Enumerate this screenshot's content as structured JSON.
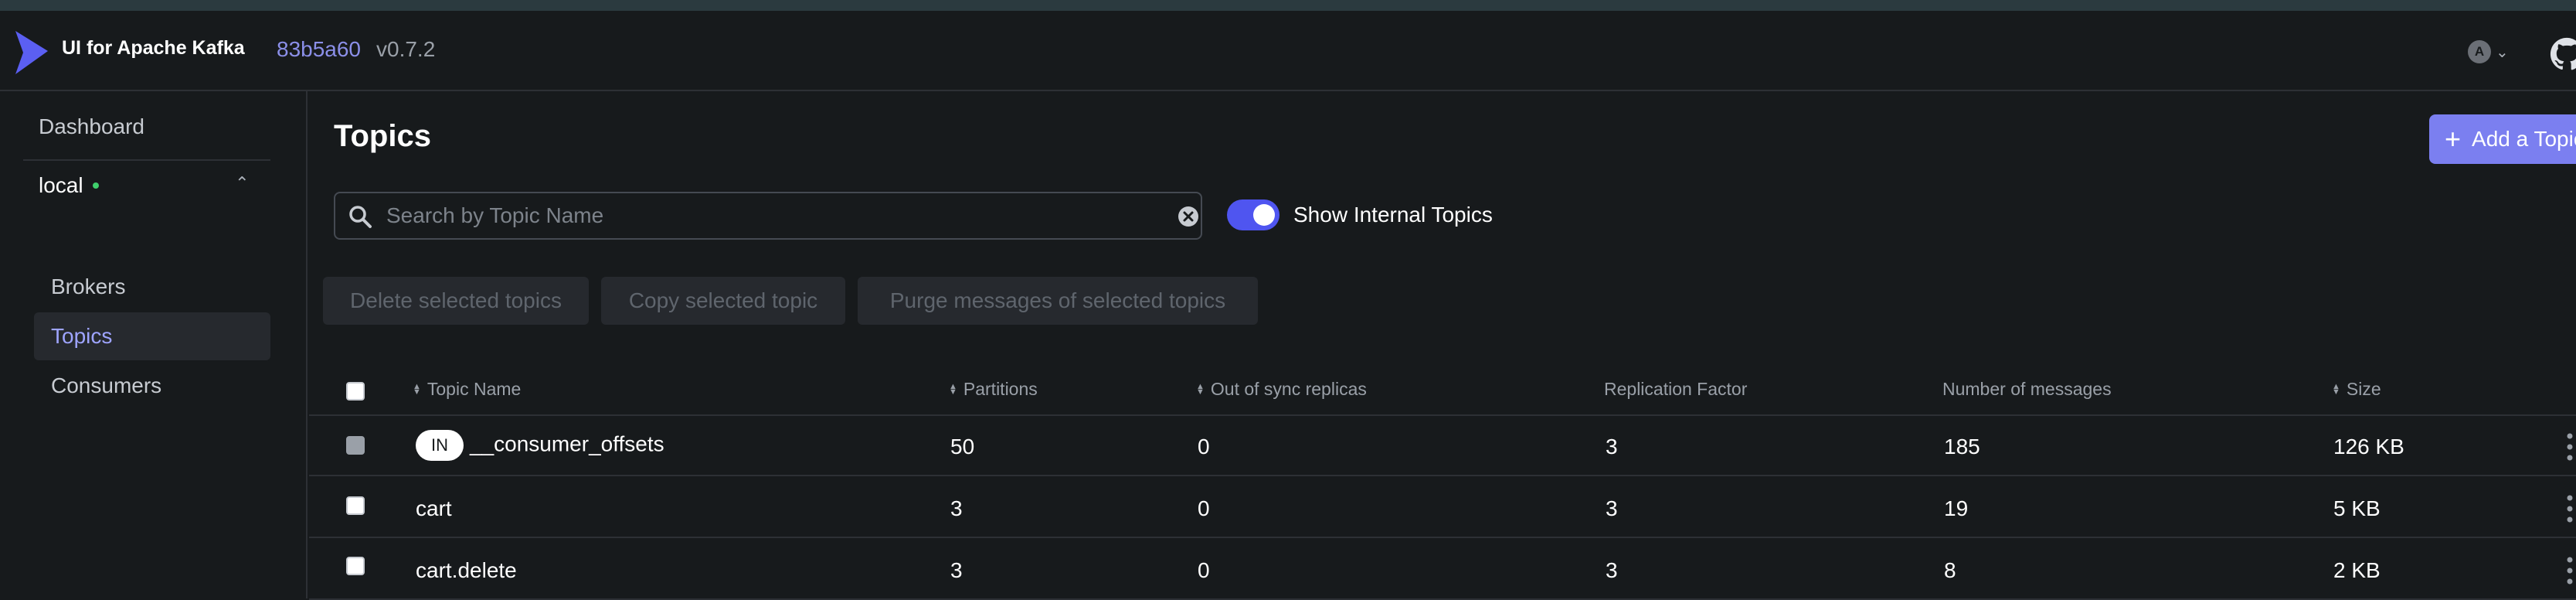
{
  "app": {
    "name": "UI for Apache Kafka",
    "version_hash": "83b5a60",
    "version": "v0.7.2",
    "user_initial": "A"
  },
  "sidebar": {
    "dashboard": "Dashboard",
    "cluster": "local",
    "items": [
      {
        "label": "Brokers",
        "active": false
      },
      {
        "label": "Topics",
        "active": true
      },
      {
        "label": "Consumers",
        "active": false
      }
    ]
  },
  "page": {
    "title": "Topics",
    "add_button": "Add a Topic"
  },
  "search": {
    "placeholder": "Search by Topic Name",
    "value": ""
  },
  "toggle": {
    "label": "Show Internal Topics",
    "on": true
  },
  "bulk_actions": {
    "delete": "Delete selected topics",
    "copy": "Copy selected topic",
    "purge": "Purge messages of selected topics"
  },
  "table": {
    "columns": {
      "name": "Topic Name",
      "partitions": "Partitions",
      "out_of_sync": "Out of sync replicas",
      "replication": "Replication Factor",
      "messages": "Number of messages",
      "size": "Size"
    },
    "rows": [
      {
        "internal_badge": "IN",
        "name": "__consumer_offsets",
        "partitions": "50",
        "out_of_sync": "0",
        "replication": "3",
        "messages": "185",
        "size": "126 KB"
      },
      {
        "internal_badge": "",
        "name": "cart",
        "partitions": "3",
        "out_of_sync": "0",
        "replication": "3",
        "messages": "19",
        "size": "5 KB"
      },
      {
        "internal_badge": "",
        "name": "cart.delete",
        "partitions": "3",
        "out_of_sync": "0",
        "replication": "3",
        "messages": "8",
        "size": "2 KB"
      }
    ]
  },
  "colors": {
    "accent": "#7b7ff0",
    "toggle_on": "#4f55f0",
    "status_online": "#3fcf6c",
    "background": "#171a1c"
  }
}
